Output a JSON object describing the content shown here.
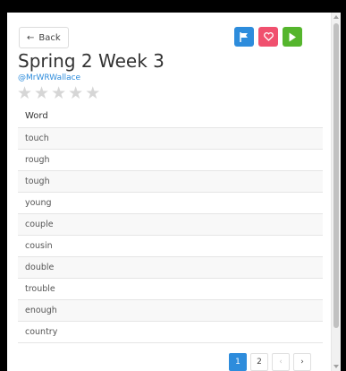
{
  "back_label": "Back",
  "title": "Spring 2 Week 3",
  "author": "@MrWRWallace",
  "rating": 0,
  "rating_max": 5,
  "table": {
    "header": "Word",
    "words": [
      "touch",
      "rough",
      "tough",
      "young",
      "couple",
      "cousin",
      "double",
      "trouble",
      "enough",
      "country"
    ]
  },
  "pagination": {
    "pages": [
      "1",
      "2"
    ],
    "current": "1",
    "prev": "‹",
    "next": "›"
  },
  "colors": {
    "flag_button": "#2d8cdc",
    "heart_button": "#f0506e",
    "play_button": "#55b52d",
    "link": "#2d8cdc"
  },
  "icons": {
    "back": "arrow-left-icon",
    "flag": "flag-icon",
    "heart": "heart-icon",
    "play": "play-icon",
    "star": "star-icon"
  }
}
